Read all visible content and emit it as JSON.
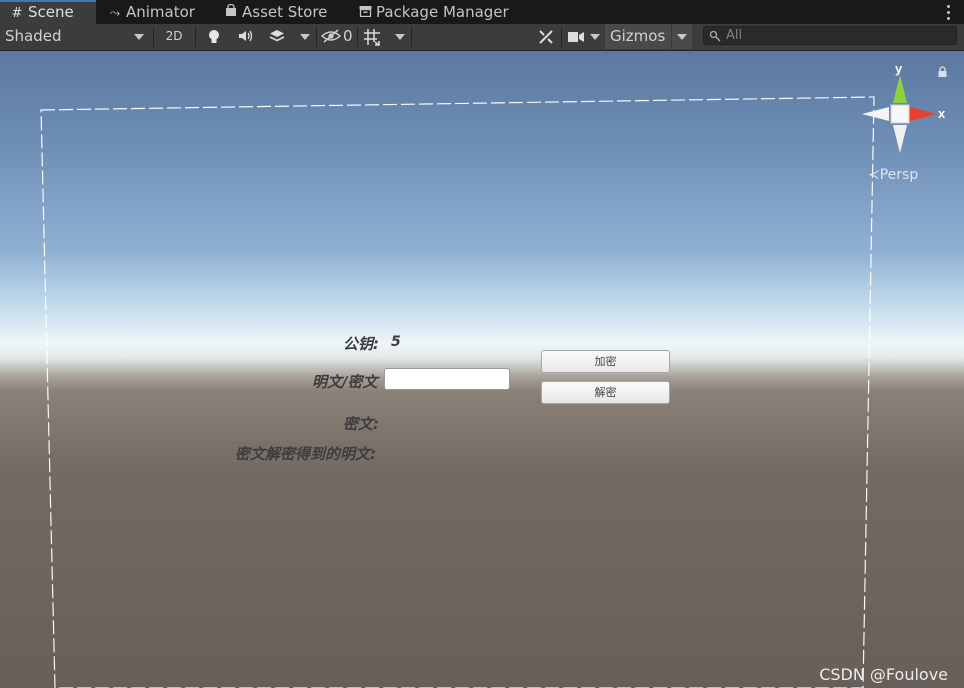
{
  "tabs": [
    {
      "label": "Scene",
      "icon": "grid-icon",
      "active": true
    },
    {
      "label": "Animator",
      "icon": "animator-icon",
      "active": false
    },
    {
      "label": "Asset Store",
      "icon": "shopping-bag-icon",
      "active": false
    },
    {
      "label": "Package Manager",
      "icon": "package-icon",
      "active": false
    }
  ],
  "toolbar": {
    "draw_mode": "Shaded",
    "mode_2d": "2D",
    "hidden_count": "0",
    "gizmos_label": "Gizmos",
    "search_placeholder": "All"
  },
  "scene": {
    "gizmo_axis_y": "y",
    "gizmo_axis_x": "x",
    "projection_label": "Persp"
  },
  "game_ui": {
    "public_key_label": "公钥:",
    "public_key_value": "5",
    "plaintext_label": "明文/密文",
    "plaintext_value": "",
    "ciphertext_label": "密文:",
    "decrypted_label": "密文解密得到的明文:",
    "encrypt_button": "加密",
    "decrypt_button": "解密"
  },
  "watermark": "CSDN @Foulove",
  "colors": {
    "tab_accent": "#3a79bb",
    "gizmo_x": "#e8402c",
    "gizmo_y": "#8ed23b",
    "sky_top": "#5a78a0",
    "horizon": "#eef6f7",
    "ground": "#685f59"
  }
}
